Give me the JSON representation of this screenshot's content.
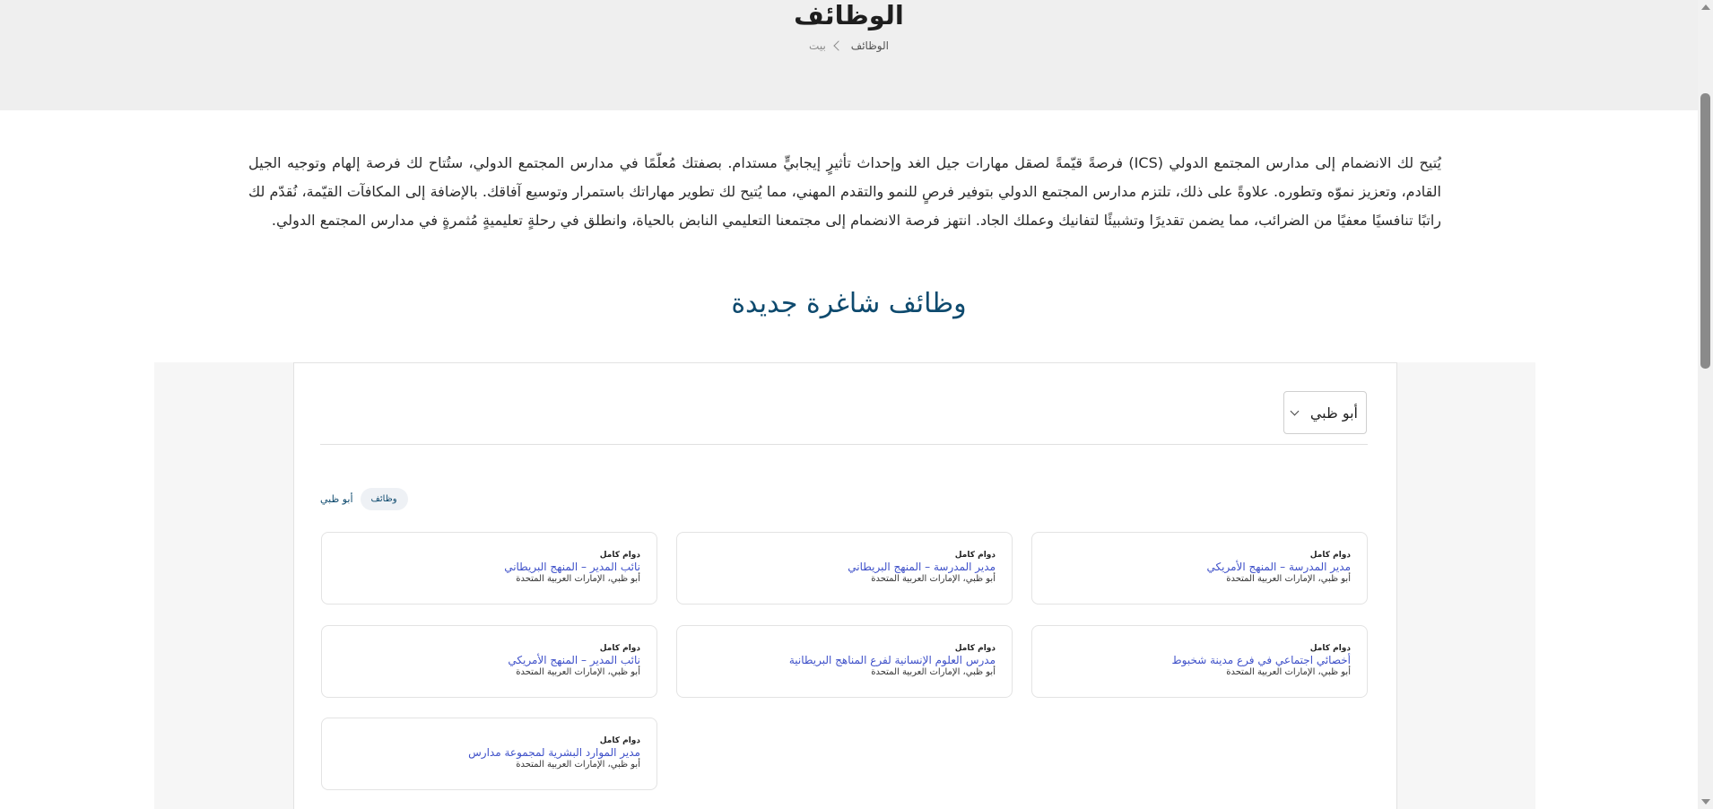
{
  "header": {
    "title": "الوظائف",
    "breadcrumb_current": "الوظائف",
    "breadcrumb_home": "بيت"
  },
  "intro": {
    "text": "يُتيح لك الانضمام إلى مدارس المجتمع الدولي (ICS) فرصةً قيّمةً لصقل مهارات جيل الغد وإحداث تأثيرٍ إيجابيٍّ مستدام. بصفتك مُعلّمًا في مدارس المجتمع الدولي، ستُتاح لك فرصة إلهام وتوجيه الجيل القادم، وتعزيز نموّه وتطوره. علاوةً على ذلك، تلتزم مدارس المجتمع الدولي بتوفير فرصٍ للنمو والتقدم المهني، مما يُتيح لك تطوير مهاراتك باستمرار وتوسيع آفاقك. بالإضافة إلى المكافآت القيّمة، نُقدّم لك راتبًا تنافسيًا معفيًا من الضرائب، مما يضمن تقديرًا وتشبيئًا لتفانيك وعملك الجاد. انتهز فرصة الانضمام إلى مجتمعنا التعليمي النابض بالحياة، وانطلق في رحلةٍ تعليميةٍ مُثمرةٍ في مدارس المجتمع الدولي."
  },
  "jobs_section": {
    "title": "وظائف شاغرة جديدة",
    "location_select": "أبو ظبي",
    "filter_location": "أبو ظبي",
    "filter_chip": "وظائف",
    "jobs": [
      {
        "type": "دوام كامل",
        "title": "مدير المدرسة – المنهج الأمريكي",
        "location": "أبو ظبي، الإمارات العربية المتحدة"
      },
      {
        "type": "دوام كامل",
        "title": "مدير المدرسة – المنهج البريطاني",
        "location": "أبو ظبي، الإمارات العربية المتحدة"
      },
      {
        "type": "دوام كامل",
        "title": "نائب المدير – المنهج البريطاني",
        "location": "أبو ظبي، الإمارات العربية المتحدة"
      },
      {
        "type": "دوام كامل",
        "title": "أخصائي اجتماعي في فرع مدينة شخبوط",
        "location": "أبو ظبي، الإمارات العربية المتحدة"
      },
      {
        "type": "دوام كامل",
        "title": "مدرس العلوم الإنسانية لفرع المناهج البريطانية",
        "location": "أبو ظبي، الإمارات العربية المتحدة"
      },
      {
        "type": "دوام كامل",
        "title": "نائب المدير – المنهج الأمريكي",
        "location": "أبو ظبي، الإمارات العربية المتحدة"
      },
      {
        "type": "دوام كامل",
        "title": "مدير الموارد البشرية لمجموعة مدارس",
        "location": "أبو ظبي، الإمارات العربية المتحدة"
      }
    ]
  }
}
